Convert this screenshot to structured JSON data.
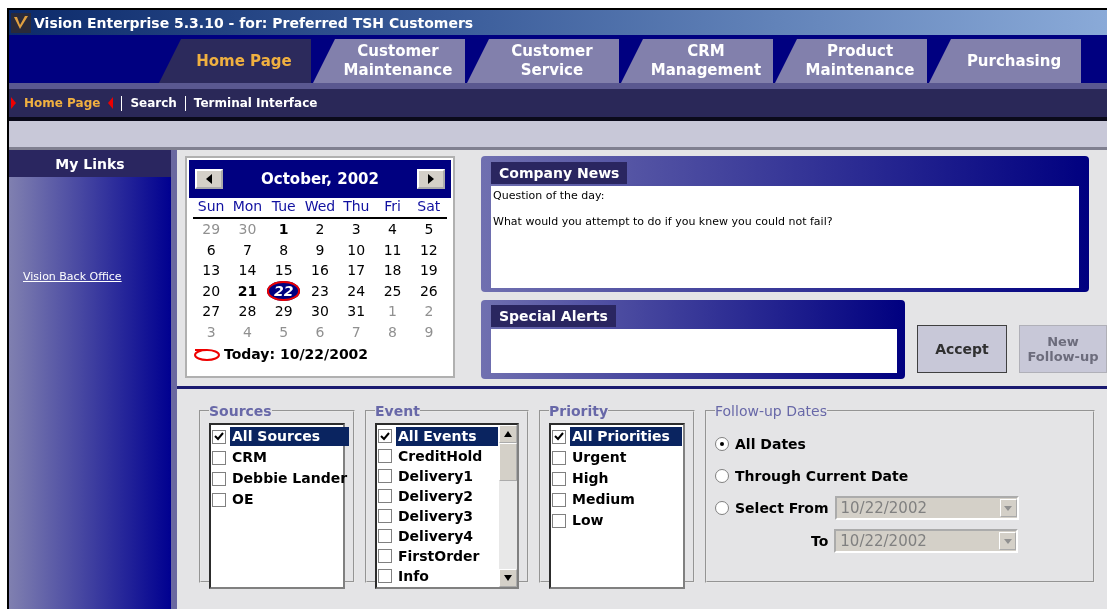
{
  "window": {
    "title": "Vision Enterprise 5.3.10 - for:  Preferred TSH Customers"
  },
  "tabs": [
    {
      "lines": [
        "Home Page"
      ],
      "selected": true
    },
    {
      "lines": [
        "Customer",
        "Maintenance"
      ],
      "selected": false
    },
    {
      "lines": [
        "Customer",
        "Service"
      ],
      "selected": false
    },
    {
      "lines": [
        "CRM",
        "Management"
      ],
      "selected": false
    },
    {
      "lines": [
        "Product",
        "Maintenance"
      ],
      "selected": false
    },
    {
      "lines": [
        "Purchasing"
      ],
      "selected": false
    }
  ],
  "subnav": [
    {
      "label": "Home Page",
      "selected": true
    },
    {
      "label": "Search",
      "selected": false
    },
    {
      "label": "Terminal Interface",
      "selected": false
    }
  ],
  "sidebar": {
    "title": "My Links",
    "links": [
      "Vision Back Office"
    ]
  },
  "calendar": {
    "month": "October, 2002",
    "weekdays": [
      "Sun",
      "Mon",
      "Tue",
      "Wed",
      "Thu",
      "Fri",
      "Sat"
    ],
    "weeks": [
      [
        {
          "day": "29",
          "muted": true,
          "bold": false,
          "selected": false
        },
        {
          "day": "30",
          "muted": true,
          "bold": false,
          "selected": false
        },
        {
          "day": "1",
          "muted": false,
          "bold": true,
          "selected": false
        },
        {
          "day": "2",
          "muted": false,
          "bold": false,
          "selected": false
        },
        {
          "day": "3",
          "muted": false,
          "bold": false,
          "selected": false
        },
        {
          "day": "4",
          "muted": false,
          "bold": false,
          "selected": false
        },
        {
          "day": "5",
          "muted": false,
          "bold": false,
          "selected": false
        }
      ],
      [
        {
          "day": "6",
          "muted": false,
          "bold": false,
          "selected": false
        },
        {
          "day": "7",
          "muted": false,
          "bold": false,
          "selected": false
        },
        {
          "day": "8",
          "muted": false,
          "bold": false,
          "selected": false
        },
        {
          "day": "9",
          "muted": false,
          "bold": false,
          "selected": false
        },
        {
          "day": "10",
          "muted": false,
          "bold": false,
          "selected": false
        },
        {
          "day": "11",
          "muted": false,
          "bold": false,
          "selected": false
        },
        {
          "day": "12",
          "muted": false,
          "bold": false,
          "selected": false
        }
      ],
      [
        {
          "day": "13",
          "muted": false,
          "bold": false,
          "selected": false
        },
        {
          "day": "14",
          "muted": false,
          "bold": false,
          "selected": false
        },
        {
          "day": "15",
          "muted": false,
          "bold": false,
          "selected": false
        },
        {
          "day": "16",
          "muted": false,
          "bold": false,
          "selected": false
        },
        {
          "day": "17",
          "muted": false,
          "bold": false,
          "selected": false
        },
        {
          "day": "18",
          "muted": false,
          "bold": false,
          "selected": false
        },
        {
          "day": "19",
          "muted": false,
          "bold": false,
          "selected": false
        }
      ],
      [
        {
          "day": "20",
          "muted": false,
          "bold": false,
          "selected": false
        },
        {
          "day": "21",
          "muted": false,
          "bold": true,
          "selected": false
        },
        {
          "day": "22",
          "muted": false,
          "bold": false,
          "selected": true
        },
        {
          "day": "23",
          "muted": false,
          "bold": false,
          "selected": false
        },
        {
          "day": "24",
          "muted": false,
          "bold": false,
          "selected": false
        },
        {
          "day": "25",
          "muted": false,
          "bold": false,
          "selected": false
        },
        {
          "day": "26",
          "muted": false,
          "bold": false,
          "selected": false
        }
      ],
      [
        {
          "day": "27",
          "muted": false,
          "bold": false,
          "selected": false
        },
        {
          "day": "28",
          "muted": false,
          "bold": false,
          "selected": false
        },
        {
          "day": "29",
          "muted": false,
          "bold": false,
          "selected": false
        },
        {
          "day": "30",
          "muted": false,
          "bold": false,
          "selected": false
        },
        {
          "day": "31",
          "muted": false,
          "bold": false,
          "selected": false
        },
        {
          "day": "1",
          "muted": true,
          "bold": false,
          "selected": false
        },
        {
          "day": "2",
          "muted": true,
          "bold": false,
          "selected": false
        }
      ],
      [
        {
          "day": "3",
          "muted": true,
          "bold": false,
          "selected": false
        },
        {
          "day": "4",
          "muted": true,
          "bold": false,
          "selected": false
        },
        {
          "day": "5",
          "muted": true,
          "bold": false,
          "selected": false
        },
        {
          "day": "6",
          "muted": true,
          "bold": false,
          "selected": false
        },
        {
          "day": "7",
          "muted": true,
          "bold": false,
          "selected": false
        },
        {
          "day": "8",
          "muted": true,
          "bold": false,
          "selected": false
        },
        {
          "day": "9",
          "muted": true,
          "bold": false,
          "selected": false
        }
      ]
    ],
    "today": "Today: 10/22/2002"
  },
  "company_news": {
    "title": "Company News",
    "lines": [
      "Question of the day:",
      "What would you attempt to do if you knew you could not fail?"
    ]
  },
  "special_alerts": {
    "title": "Special Alerts"
  },
  "buttons": [
    {
      "label": "Accept",
      "disabled": false
    },
    {
      "label": "New Follow-up",
      "disabled": true
    }
  ],
  "filters": [
    {
      "title": "Sources",
      "scrollbar": false,
      "items": [
        {
          "label": "All Sources",
          "checked": true,
          "selected": true
        },
        {
          "label": "CRM",
          "checked": false,
          "selected": false
        },
        {
          "label": "Debbie Lander",
          "checked": false,
          "selected": false
        },
        {
          "label": "OE",
          "checked": false,
          "selected": false
        }
      ]
    },
    {
      "title": "Event",
      "scrollbar": true,
      "items": [
        {
          "label": "All Events",
          "checked": true,
          "selected": true
        },
        {
          "label": "CreditHold",
          "checked": false,
          "selected": false
        },
        {
          "label": "Delivery1",
          "checked": false,
          "selected": false
        },
        {
          "label": "Delivery2",
          "checked": false,
          "selected": false
        },
        {
          "label": "Delivery3",
          "checked": false,
          "selected": false
        },
        {
          "label": "Delivery4",
          "checked": false,
          "selected": false
        },
        {
          "label": "FirstOrder",
          "checked": false,
          "selected": false
        },
        {
          "label": "Info",
          "checked": false,
          "selected": false
        }
      ]
    },
    {
      "title": "Priority",
      "scrollbar": false,
      "items": [
        {
          "label": "All Priorities",
          "checked": true,
          "selected": true
        },
        {
          "label": "Urgent",
          "checked": false,
          "selected": false
        },
        {
          "label": "High",
          "checked": false,
          "selected": false
        },
        {
          "label": "Medium",
          "checked": false,
          "selected": false
        },
        {
          "label": "Low",
          "checked": false,
          "selected": false
        }
      ]
    }
  ],
  "follow_up_dates": {
    "title": "Follow-up Dates",
    "options": [
      {
        "label": "All Dates",
        "selected": true
      },
      {
        "label": "Through Current Date",
        "selected": false
      },
      {
        "label": "Select  From",
        "selected": false
      }
    ],
    "from": {
      "value": "10/22/2002",
      "disabled": true
    },
    "to_label": "To",
    "to": {
      "value": "10/22/2002",
      "disabled": true
    }
  }
}
